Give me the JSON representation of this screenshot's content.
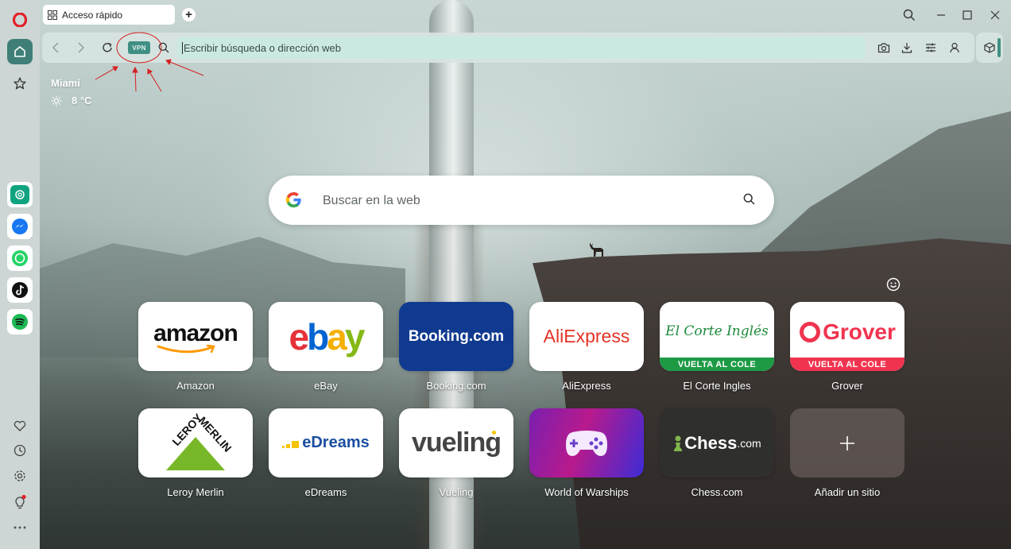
{
  "tabs": [
    {
      "label": "Acceso rápido"
    }
  ],
  "address_bar": {
    "placeholder": "Escribir búsqueda o dirección web",
    "vpn_label": "VPN"
  },
  "weather": {
    "city": "Miami",
    "temperature": "8 °C"
  },
  "search": {
    "placeholder": "Buscar en la web"
  },
  "speed_dials": [
    {
      "label": "Amazon",
      "logo": "amazon"
    },
    {
      "label": "eBay",
      "logo": "ebay"
    },
    {
      "label": "Booking.com",
      "logo": "Booking.com"
    },
    {
      "label": "AliExpress",
      "logo": "AliExpress"
    },
    {
      "label": "El Corte Ingles",
      "logo": "El Corte Inglés",
      "banner": "VUELTA AL COLE"
    },
    {
      "label": "Grover",
      "logo": "Grover",
      "banner": "VUELTA AL COLE"
    },
    {
      "label": "Leroy Merlin",
      "logo": "LEROY MERLIN"
    },
    {
      "label": "eDreams",
      "logo": "eDreams"
    },
    {
      "label": "Vueling",
      "logo": "vueling"
    },
    {
      "label": "World of Warships",
      "logo": "gamepad-icon"
    },
    {
      "label": "Chess.com",
      "logo_main": "Chess",
      "logo_suffix": ".com"
    },
    {
      "label": "Añadir un sitio",
      "logo": "plus-icon"
    }
  ],
  "colors": {
    "accent": "#3f8f84",
    "sidebar_bg": "#cdd6d4",
    "omnibox_bg": "#cbe9e3",
    "opera_red": "#e0202a",
    "annotation_red": "#d42020",
    "booking_blue": "#0f3a8f",
    "eci_green": "#1e9a45",
    "grover_red": "#f0344f"
  },
  "sidebar_icons": [
    "opera-logo-icon",
    "home-icon",
    "star-icon",
    "chatgpt-icon",
    "messenger-icon",
    "whatsapp-icon",
    "tiktok-icon",
    "spotify-icon",
    "heart-icon",
    "history-icon",
    "settings-icon",
    "lightbulb-icon",
    "more-icon"
  ]
}
